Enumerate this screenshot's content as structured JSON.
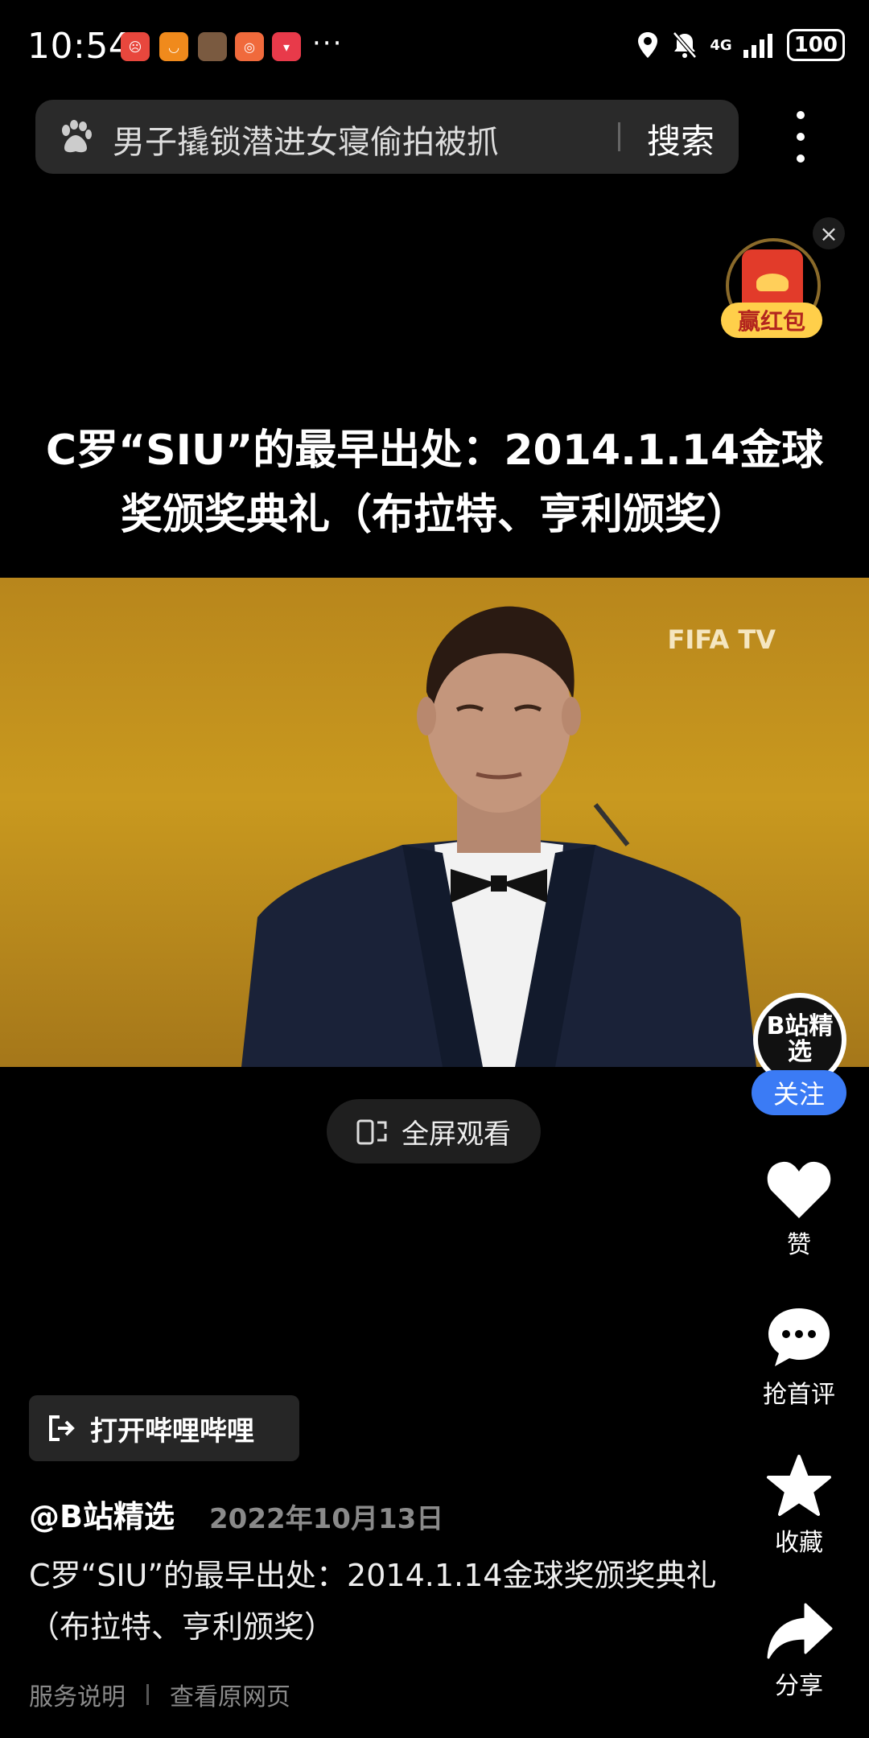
{
  "status_bar": {
    "time": "10:54",
    "dots": "···",
    "battery": "100",
    "network": "4G"
  },
  "search": {
    "query": "男子撬锁潜进女寝偷拍被抓",
    "button": "搜索"
  },
  "red_packet": {
    "label": "赢红包"
  },
  "post": {
    "title": "C罗“SIU”的最早出处：2014.1.14金球奖颁奖典礼（布拉特、亨利颁奖）",
    "video_watermark": "FIFA TV",
    "fullscreen_label": "全屏观看",
    "open_app_label": "打开哔哩哔哩",
    "author": "@B站精选",
    "date": "2022年10月13日",
    "description": "C罗“SIU”的最早出处：2014.1.14金球奖颁奖典礼（布拉特、亨利颁奖）"
  },
  "sidebar": {
    "avatar_text": "B站精选",
    "follow": "关注",
    "like": "赞",
    "comment": "抢首评",
    "favorite": "收藏",
    "share": "分享"
  },
  "footer": {
    "service": "服务说明",
    "view_source": "查看原网页"
  },
  "colors": {
    "follow_blue": "#3b7bf5",
    "video_gold": "#c9991f",
    "red_packet_gold": "#ffcf4a"
  }
}
